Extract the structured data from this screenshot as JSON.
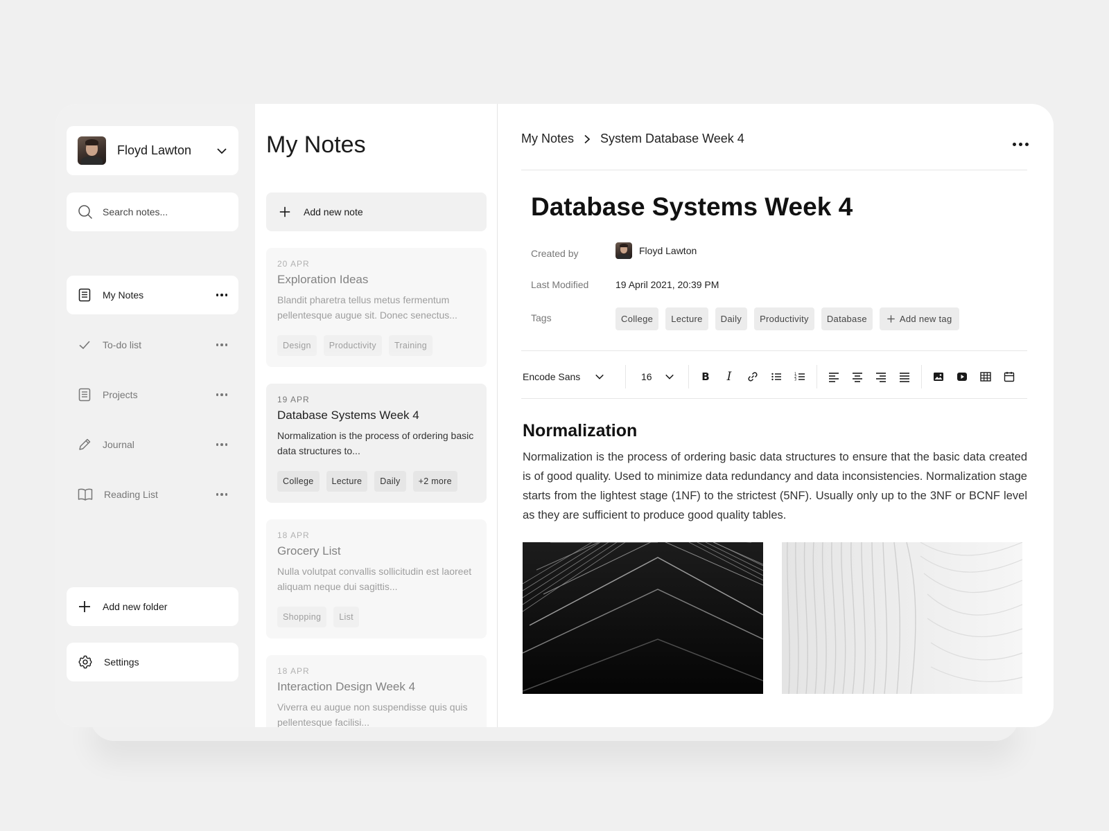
{
  "user": {
    "name": "Floyd Lawton"
  },
  "search": {
    "placeholder": "Search notes..."
  },
  "nav": [
    {
      "label": "My Notes",
      "icon": "note-icon",
      "active": true
    },
    {
      "label": "To-do list",
      "icon": "check-icon",
      "active": false
    },
    {
      "label": "Projects",
      "icon": "document-icon",
      "active": false
    },
    {
      "label": "Journal",
      "icon": "pencil-icon",
      "active": false
    },
    {
      "label": "Reading List",
      "icon": "book-icon",
      "active": false
    }
  ],
  "sidebar": {
    "add_folder_label": "Add new folder",
    "settings_label": "Settings"
  },
  "notes_list": {
    "title": "My Notes",
    "add_note_label": "Add new note",
    "notes": [
      {
        "date": "20 APR",
        "title": "Exploration Ideas",
        "snippet": "Blandit pharetra tellus metus fermentum pellentesque augue sit. Donec senectus...",
        "tags": [
          "Design",
          "Productivity",
          "Training"
        ]
      },
      {
        "date": "19 APR",
        "title": "Database Systems Week 4",
        "snippet": "Normalization is the process of ordering basic data structures to...",
        "tags": [
          "College",
          "Lecture",
          "Daily",
          "+2 more"
        ]
      },
      {
        "date": "18 APR",
        "title": "Grocery List",
        "snippet": "Nulla volutpat convallis sollicitudin est laoreet aliquam neque dui sagittis...",
        "tags": [
          "Shopping",
          "List"
        ]
      },
      {
        "date": "18 APR",
        "title": "Interaction Design Week 4",
        "snippet": "Viverra eu augue non suspendisse quis quis pellentesque facilisi...",
        "tags": []
      }
    ]
  },
  "editor": {
    "breadcrumb": [
      "My Notes",
      "System Database Week 4"
    ],
    "title": "Database Systems Week 4",
    "meta": {
      "created_by_label": "Created by",
      "created_by": "Floyd Lawton",
      "last_modified_label": "Last Modified",
      "last_modified": "19 April 2021, 20:39 PM",
      "tags_label": "Tags",
      "tags": [
        "College",
        "Lecture",
        "Daily",
        "Productivity",
        "Database"
      ],
      "add_tag_label": "Add new tag"
    },
    "toolbar": {
      "font": "Encode Sans",
      "size": "16"
    },
    "section_heading": "Normalization",
    "body": "Normalization is the process of ordering basic data structures to ensure that the basic data created is of good quality. Used to minimize data redundancy and data inconsistencies. Normalization stage starts from the lightest stage (1NF) to the strictest (5NF). Usually only up to the 3NF or BCNF level as they are sufficient to produce good quality tables."
  },
  "colors": {
    "background": "#f0f0f0",
    "sidebar": "#f1f1f1",
    "text": "#1a1a1a",
    "muted": "#777777"
  }
}
